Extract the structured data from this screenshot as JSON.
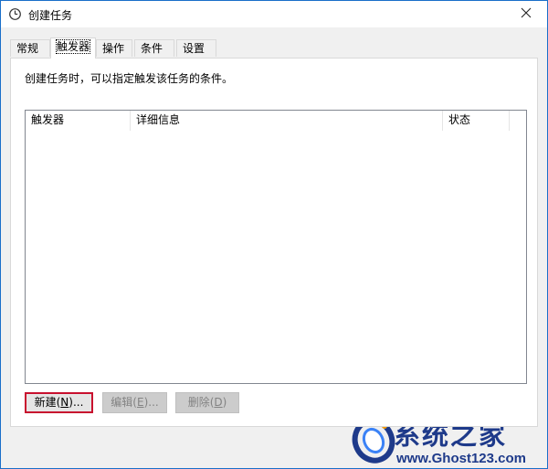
{
  "window": {
    "title": "创建任务",
    "icon": "clock-icon",
    "close_icon": "close-icon"
  },
  "tabs": [
    {
      "label": "常规",
      "active": false
    },
    {
      "label": "触发器",
      "active": true
    },
    {
      "label": "操作",
      "active": false
    },
    {
      "label": "条件",
      "active": false
    },
    {
      "label": "设置",
      "active": false
    }
  ],
  "panel": {
    "description": "创建任务时，可以指定触发该任务的条件。"
  },
  "list": {
    "columns": [
      "触发器",
      "详细信息",
      "状态"
    ],
    "rows": []
  },
  "buttons": {
    "new": {
      "text": "新建(",
      "key": "N",
      "suffix": ")...",
      "enabled": true
    },
    "edit": {
      "text": "编辑(",
      "key": "E",
      "suffix": ")...",
      "enabled": false
    },
    "delete": {
      "text": "删除(",
      "key": "D",
      "suffix": ")",
      "enabled": false
    }
  },
  "watermark": {
    "name": "系统之家",
    "url": "www.Ghost123.com"
  },
  "colors": {
    "window_border": "#1a6fc9",
    "default_button_border": "#c8102e",
    "watermark": "#1e3a8a"
  }
}
